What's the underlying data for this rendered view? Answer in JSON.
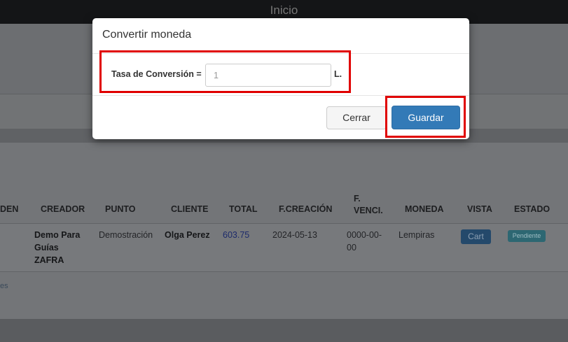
{
  "topbar": {
    "title": "Inicio"
  },
  "table": {
    "headers": [
      "DEN",
      "CREADOR",
      "PUNTO",
      "CLIENTE",
      "TOTAL",
      "F.CREACIÓN",
      "F.",
      "VENCI.",
      "MONEDA",
      "VISTA",
      "ESTADO"
    ],
    "row": {
      "creador": [
        "Demo Para",
        "Guías",
        "ZAFRA"
      ],
      "punto": "Demostración",
      "cliente": "Olga Perez",
      "total": "603.75",
      "f_creacion": "2024-05-13",
      "f_venci": [
        "0000-00-",
        "00"
      ],
      "moneda": "Lempiras",
      "vista": "Cart",
      "estado": "Pendiente"
    },
    "footer_stub": "es"
  },
  "modal": {
    "title": "Convertir moneda",
    "rate_label": "Tasa de Conversión =",
    "rate_placeholder": "1",
    "unit": "L.",
    "close_label": "Cerrar",
    "save_label": "Guardar"
  },
  "colors": {
    "primary": "#337ab7",
    "highlight": "#e00000"
  }
}
